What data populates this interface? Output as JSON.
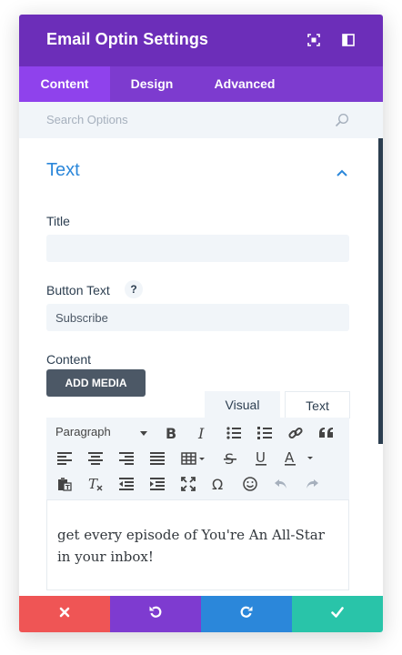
{
  "header": {
    "title": "Email Optin Settings",
    "icons": [
      "focus-icon",
      "sidebar-layout-icon"
    ]
  },
  "tabs": [
    {
      "label": "Content",
      "active": true
    },
    {
      "label": "Design",
      "active": false
    },
    {
      "label": "Advanced",
      "active": false
    }
  ],
  "search": {
    "placeholder": "Search Options",
    "icon": "search-icon"
  },
  "section": {
    "title": "Text",
    "icon": "chevron-up-icon"
  },
  "fields": {
    "title_label": "Title",
    "title_value": "",
    "button_text_label": "Button Text",
    "button_text_help": "?",
    "button_text_value": "Subscribe",
    "content_label": "Content"
  },
  "editor": {
    "add_media_label": "ADD MEDIA",
    "visual_tab": "Visual",
    "text_tab": "Text",
    "format_select": "Paragraph",
    "content": "get every episode of You're An All-Star in your inbox!"
  },
  "footer": {
    "buttons": [
      "close-icon",
      "undo-icon",
      "redo-icon",
      "check-icon"
    ],
    "colors": [
      "#ef5555",
      "#7e3bd0",
      "#2b87da",
      "#29c4a9"
    ]
  },
  "colors": {
    "header": "#6c2eb9",
    "tabs": "#7d3bcf",
    "active_tab": "#8f42ec",
    "section_title": "#2b87da"
  }
}
